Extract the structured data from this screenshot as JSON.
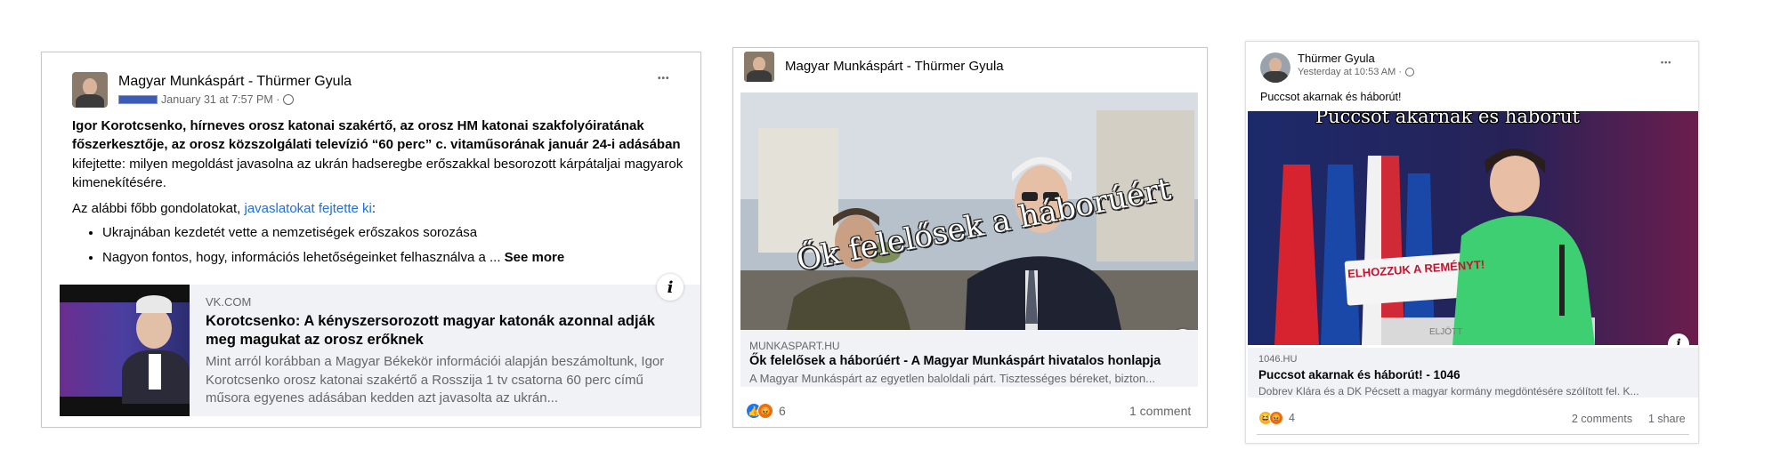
{
  "post1": {
    "page_name": "Magyar Munkáspárt - Thürmer Gyula",
    "timestamp": "January 31 at 7:57 PM · ",
    "more": "•••",
    "para1_bold1": "Igor Korotcsenko, hírneves orosz katonai szakértő, az orosz HM katonai szakfolyóiratának főszerkesztője, az orosz közszolgálati televízió “60 perc” c. vitaműsorának január 24-i adásában",
    "para1_rest": " kifejtette: milyen megoldást javasolna az ukrán hadseregbe erőszakkal besorozott kárpátaljai magyarok kimenekítésére.",
    "para2_pre": "Az alábbi főbb gondolatokat, ",
    "para2_link": "javaslatokat fejtette ki",
    "para2_post": ":",
    "bullet1": "Ukrajnában kezdetét vette a nemzetiségek erőszakos sorozása",
    "bullet2": "Nagyon fontos, hogy, információs lehetőségeinket felhasználva a ... ",
    "see_more": "See more",
    "link": {
      "domain": "VK.COM",
      "title": "Korotcsenko: A kényszersorozott magyar katonák azonnal adják meg magukat az orosz erőknek",
      "desc": "Mint arról korábban a Magyar Békekör információi alapján beszámoltunk, Igor Korotcsenko orosz katonai szakértő a Rosszija 1 tv csatorna 60 perc című műsora egyenes adásában kedden azt javasolta az ukrán..."
    },
    "info": "i"
  },
  "post2": {
    "page_name": "Magyar Munkáspárt - Thürmer Gyula",
    "image_caption": "Ők  felelősek a háborúért",
    "link": {
      "domain": "MUNKASPART.HU",
      "title": "Ők felelősek a háborúért - A Magyar Munkáspárt hivatalos honlapja",
      "desc": "A Magyar Munkáspárt az egyetlen baloldali párt. Tisztességes béreket, bizton..."
    },
    "reaction_count": "6",
    "comments": "1 comment",
    "info": "i"
  },
  "post3": {
    "page_name": "Thürmer Gyula",
    "timestamp": "Yesterday at 10:53 AM · ",
    "more": "•••",
    "text": "Puccsot akarnak és háborút!",
    "image_caption": "Puccsot akarnak és háborút",
    "podium_text": "ELHOZZUK A REMÉNYT!",
    "podium_sub": "ELJÖTT",
    "link": {
      "domain": "1046.HU",
      "title": "Puccsot akarnak és háborút! - 1046",
      "desc": "Dobrev Klára és a DK Pécsett a magyar kormány megdöntésére szólított fel. K..."
    },
    "reaction_count": "4",
    "comments": "2 comments",
    "shares": "1 share",
    "info": "i"
  },
  "colors": {
    "link": "#216fdb",
    "meta": "#65676b",
    "like": "#1877f2",
    "angry": "#e9710f",
    "haha": "#f7b125"
  }
}
